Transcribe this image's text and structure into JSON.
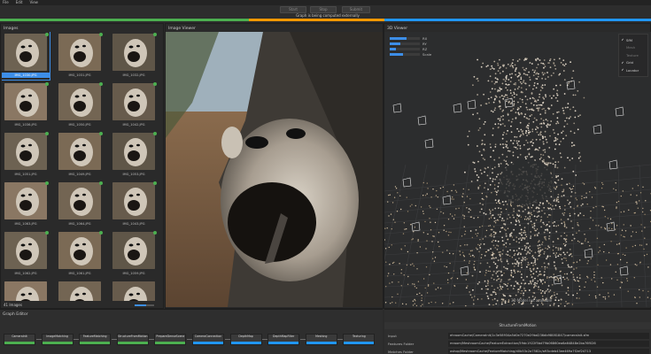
{
  "menu": [
    "File",
    "Edit",
    "View"
  ],
  "toolbar": {
    "start_label": "Start",
    "stop_label": "Stop",
    "submit_label": "Submit",
    "status": "Graph is being computed externally"
  },
  "progress_colors": [
    "#4caf50",
    "#ff9800",
    "#2196f3"
  ],
  "images_panel": {
    "title": "Images",
    "count_label": "41 Images",
    "zoom_fraction": 0.6,
    "thumbnails": [
      {
        "name": "IMG_1030.JPG",
        "selected": true
      },
      {
        "name": "IMG_1031.JPG"
      },
      {
        "name": "IMG_1032.JPG"
      },
      {
        "name": "IMG_1036.JPG"
      },
      {
        "name": "IMG_1050.JPG"
      },
      {
        "name": "IMG_1042.JPG"
      },
      {
        "name": "IMG_1051.JPG"
      },
      {
        "name": "IMG_1049.JPG"
      },
      {
        "name": "IMG_1053.JPG"
      },
      {
        "name": "IMG_1063.JPG"
      },
      {
        "name": "IMG_1064.JPG"
      },
      {
        "name": "IMG_1043.JPG"
      },
      {
        "name": "IMG_1062.JPG"
      },
      {
        "name": "IMG_1061.JPG"
      },
      {
        "name": "IMG_1059.JPG"
      },
      {
        "name": "",
        "partial": true
      },
      {
        "name": "",
        "partial": true
      },
      {
        "name": "",
        "partial": true
      }
    ]
  },
  "image_viewer": {
    "title": "Image Viewer"
  },
  "viewer_3d": {
    "title": "3D Viewer",
    "camera_controls": [
      {
        "label": "RX",
        "value": 0.55
      },
      {
        "label": "RY",
        "value": 0.35
      },
      {
        "label": "RZ",
        "value": 0.2
      },
      {
        "label": "Scale",
        "value": 0.45
      }
    ],
    "layers": [
      {
        "label": "SfM",
        "on": true
      },
      {
        "label": "Mesh",
        "on": false
      },
      {
        "label": "Texture",
        "on": false
      },
      {
        "label": "Grid",
        "on": true
      },
      {
        "label": "Locator",
        "on": true
      }
    ],
    "status": "3D Model not available"
  },
  "graph_editor": {
    "title": "Graph Editor",
    "nodes": [
      {
        "label": "CameraInit",
        "color": "#4caf50"
      },
      {
        "label": "ImageMatching",
        "color": "#4caf50"
      },
      {
        "label": "FeatureMatching",
        "color": "#4caf50"
      },
      {
        "label": "StructureFromMotion",
        "color": "#4caf50"
      },
      {
        "label": "PrepareDenseScene",
        "color": "#4caf50"
      },
      {
        "label": "CameraConnection",
        "color": "#2196f3"
      },
      {
        "label": "DepthMap",
        "color": "#2196f3"
      },
      {
        "label": "DepthMapFilter",
        "color": "#2196f3"
      },
      {
        "label": "Meshing",
        "color": "#2196f3"
      },
      {
        "label": "Texturing",
        "color": "#2196f3"
      }
    ]
  },
  "attribute_editor": {
    "node_title": "StructureFromMotion",
    "rows": [
      {
        "key": "Input",
        "value": "ehroomCache/CameraInit/1c3e58934a5d0e7270e29bd236db98081847/cameraInit.sfm"
      },
      {
        "key": "Features Folder",
        "value": "mroom/MeshroomCache/FeatureExtraction/59dc1922f5bd79b06860ea6a64848e2ba76f026"
      },
      {
        "key": "Matches Folder",
        "value": "oshop/MeshroomCache/FeatureMatching/d0b53c2a7582c/a93cdeb43ee469a7f2ef24713"
      }
    ]
  }
}
